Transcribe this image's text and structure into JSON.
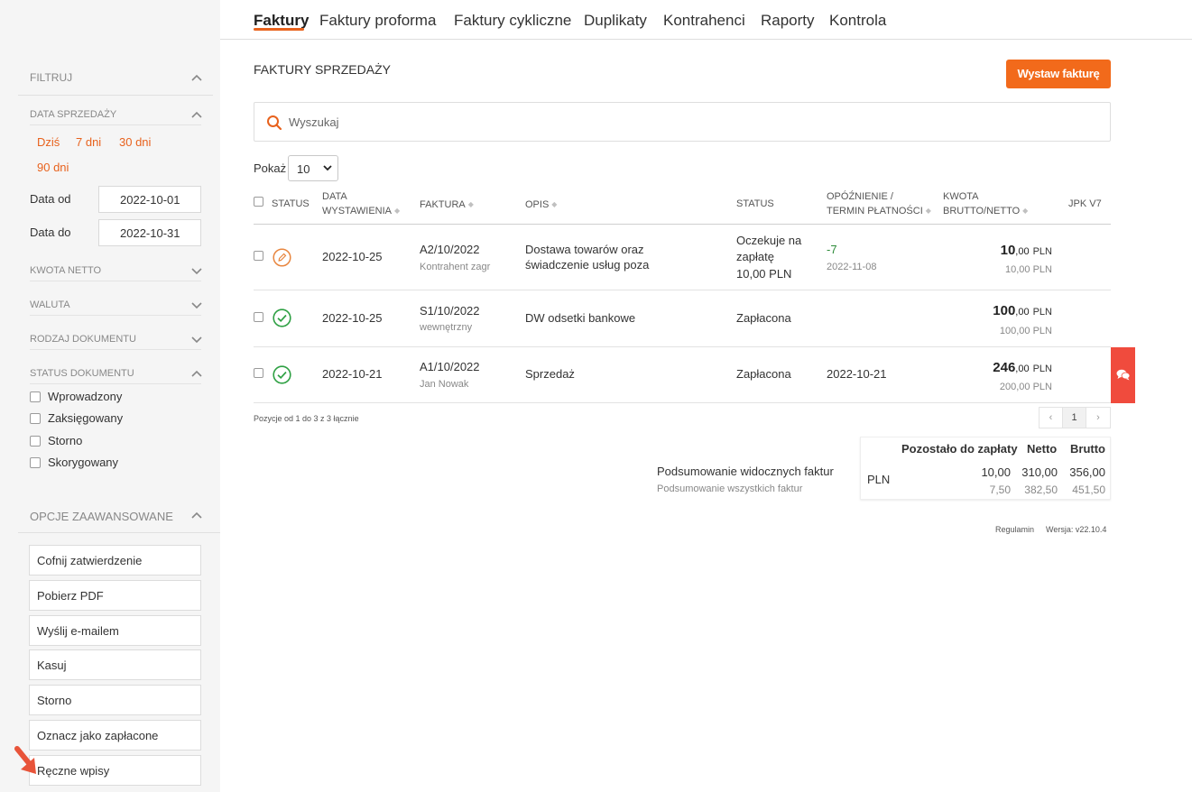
{
  "tabs": [
    {
      "label": "Faktury",
      "active": true
    },
    {
      "label": "Faktury proforma"
    },
    {
      "label": "Faktury cykliczne"
    },
    {
      "label": "Duplikaty"
    },
    {
      "label": "Kontrahenci"
    },
    {
      "label": "Raporty"
    },
    {
      "label": "Kontrola"
    }
  ],
  "sidebar": {
    "filter_title": "FILTRUJ",
    "sales_date_title": "DATA SPRZEDAŻY",
    "quick_ranges": [
      "Dziś",
      "7 dni",
      "30 dni",
      "90 dni"
    ],
    "date_from_label": "Data od",
    "date_from_value": "2022-10-01",
    "date_to_label": "Data do",
    "date_to_value": "2022-10-31",
    "sections": [
      "KWOTA NETTO",
      "WALUTA",
      "RODZAJ DOKUMENTU"
    ],
    "status_title": "STATUS DOKUMENTU",
    "statuses": [
      "Wprowadzony",
      "Zaksięgowany",
      "Storno",
      "Skorygowany"
    ],
    "advanced_title": "OPCJE ZAAWANSOWANE",
    "advanced_buttons": [
      "Cofnij zatwierdzenie",
      "Pobierz PDF",
      "Wyślij e-mailem",
      "Kasuj",
      "Storno",
      "Oznacz jako zapłacone",
      "Ręczne wpisy"
    ]
  },
  "main": {
    "title": "FAKTURY SPRZEDAŻY",
    "issue_button": "Wystaw fakturę",
    "search_placeholder": "Wyszukaj",
    "show_label": "Pokaż",
    "show_value": "10",
    "columns": {
      "status": "STATUS",
      "date_l1": "DATA",
      "date_l2": "WYSTAWIENIA",
      "invoice": "FAKTURA",
      "desc": "OPIS",
      "status2": "STATUS",
      "delay_l1": "OPÓŹNIENIE /",
      "delay_l2": "TERMIN PŁATNOŚCI",
      "amount_l1": "KWOTA",
      "amount_l2": "BRUTTO/NETTO",
      "jpk": "JPK V7"
    },
    "rows": [
      {
        "icon": "pencil-icon",
        "date": "2022-10-25",
        "number": "A2/10/2022",
        "client": "Kontrahent zagr",
        "desc_l1": "Dostawa towarów oraz",
        "desc_l2": "świadczenie usług poza",
        "status_l1": "Oczekuje na",
        "status_l2": "zapłatę",
        "status_l3": "10,00 PLN",
        "delay": "-7",
        "due": "2022-11-08",
        "gross_int": "10",
        "gross_dec": ",00",
        "currency": "PLN",
        "net": "10,00 PLN"
      },
      {
        "icon": "check-circle-icon",
        "date": "2022-10-25",
        "number": "S1/10/2022",
        "client": "wewnętrzny",
        "desc_l1": "DW odsetki bankowe",
        "status_l1": "Zapłacona",
        "gross_int": "100",
        "gross_dec": ",00",
        "currency": "PLN",
        "net": "100,00 PLN"
      },
      {
        "icon": "check-circle-icon",
        "date": "2022-10-21",
        "number": "A1/10/2022",
        "client": "Jan Nowak",
        "desc_l1": "Sprzedaż",
        "status_l1": "Zapłacona",
        "due": "2022-10-21",
        "gross_int": "246",
        "gross_dec": ",00",
        "currency": "PLN",
        "net": "200,00 PLN"
      }
    ],
    "pagination_info": "Pozycje od 1 do 3 z 3 łącznie",
    "page_prev": "‹",
    "page_current": "1",
    "page_next": "›",
    "summary": {
      "visible_label": "Podsumowanie widocznych faktur",
      "all_label": "Podsumowanie wszystkich faktur",
      "col_remaining": "Pozostało do zapłaty",
      "col_net": "Netto",
      "col_gross": "Brutto",
      "currency": "PLN",
      "visible": {
        "remaining": "10,00",
        "net": "310,00",
        "gross": "356,00"
      },
      "all": {
        "remaining": "7,50",
        "net": "382,50",
        "gross": "451,50"
      }
    },
    "footer_terms": "Regulamin",
    "footer_version": "Wersja: v22.10.4"
  },
  "colors": {
    "accent": "#e8621d",
    "button": "#f26a1b",
    "success": "#2ea043",
    "chat": "#f04b3d"
  }
}
